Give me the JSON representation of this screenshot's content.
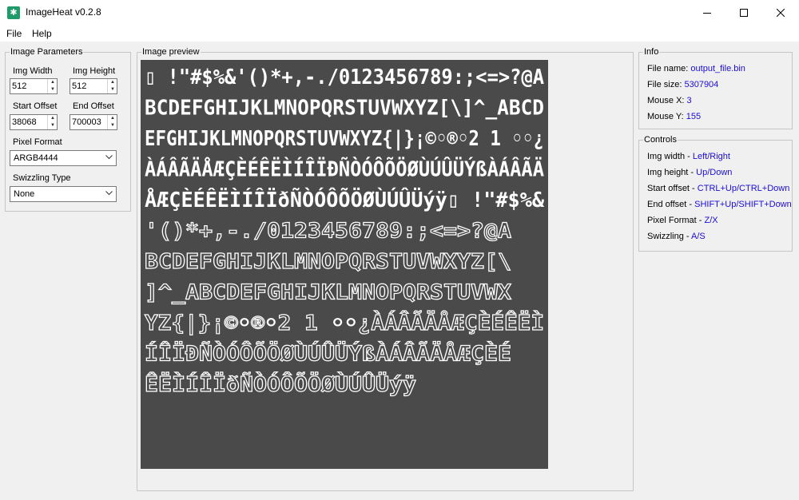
{
  "window": {
    "title": "ImageHeat v0.2.8",
    "icon": "bug-icon",
    "accent": "#1f9b6a"
  },
  "menu": {
    "file": "File",
    "help": "Help"
  },
  "params": {
    "title": "Image Parameters",
    "img_width_label": "Img Width",
    "img_width_value": "512",
    "img_height_label": "Img Height",
    "img_height_value": "512",
    "start_offset_label": "Start Offset",
    "start_offset_value": "38068",
    "end_offset_label": "End Offset",
    "end_offset_value": "700003",
    "pixel_format_label": "Pixel Format",
    "pixel_format_value": "ARGB4444",
    "swizzling_label": "Swizzling Type",
    "swizzling_value": "None"
  },
  "preview": {
    "title": "Image preview",
    "background": "#4a4a4a",
    "glyph_rows": [
      "▯ !\"#$%&'()*+,-./0123456789:;<=>?@A",
      "BCDEFGHIJKLMNOPQRSTUVWXYZ[\\]^_ABCD",
      "EFGHIJKLMNOPQRSTUVWXYZ{|}¡©◦®◦2 1 ◦◦¿",
      "ÀÁÂÃÄÅÆÇÈÉÊËÌÍÎÏÐÑÒÓÔÕÖØÙÚÛÜÝßÀÁÂÃÄ",
      "ÅÆÇÈÉÊËÌÍÎÏðÑÒÓÔÕÖØÙÚÛÜýÿ▯ !\"#$%&",
      "'()*+,-./0123456789:;<=>?@A",
      "BCDEFGHIJKLMNOPQRSTUVWXYZ[\\",
      "]^_ABCDEFGHIJKLMNOPQRSTUVWX",
      "YZ{|}¡©◦®◦2 1 ◦◦¿ÀÁÂÃÄÅÆÇÈÉÊËÌ",
      "ÍÎÏÐÑÒÓÔÕÖØÙÚÛÜÝßÀÁÂÃÄÅÆÇÈÉ",
      "ÊËÌÍÎÏðÑÒÓÔÕÖØÙÚÛÜýÿ"
    ]
  },
  "info": {
    "title": "Info",
    "file_name_label": "File name:",
    "file_name_value": "output_file.bin",
    "file_size_label": "File size:",
    "file_size_value": "5307904",
    "mouse_x_label": "Mouse X:",
    "mouse_x_value": "3",
    "mouse_y_label": "Mouse Y:",
    "mouse_y_value": "155"
  },
  "controls": {
    "title": "Controls",
    "rows": [
      {
        "label": "Img width - ",
        "keys": "Left/Right"
      },
      {
        "label": "Img height - ",
        "keys": "Up/Down"
      },
      {
        "label": "Start offset - ",
        "keys": "CTRL+Up/CTRL+Down"
      },
      {
        "label": "End offset - ",
        "keys": "SHIFT+Up/SHIFT+Down"
      },
      {
        "label": "Pixel Format - ",
        "keys": "Z/X"
      },
      {
        "label": "Swizzling - ",
        "keys": "A/S"
      }
    ]
  },
  "colors": {
    "link": "#1a0dd6"
  }
}
